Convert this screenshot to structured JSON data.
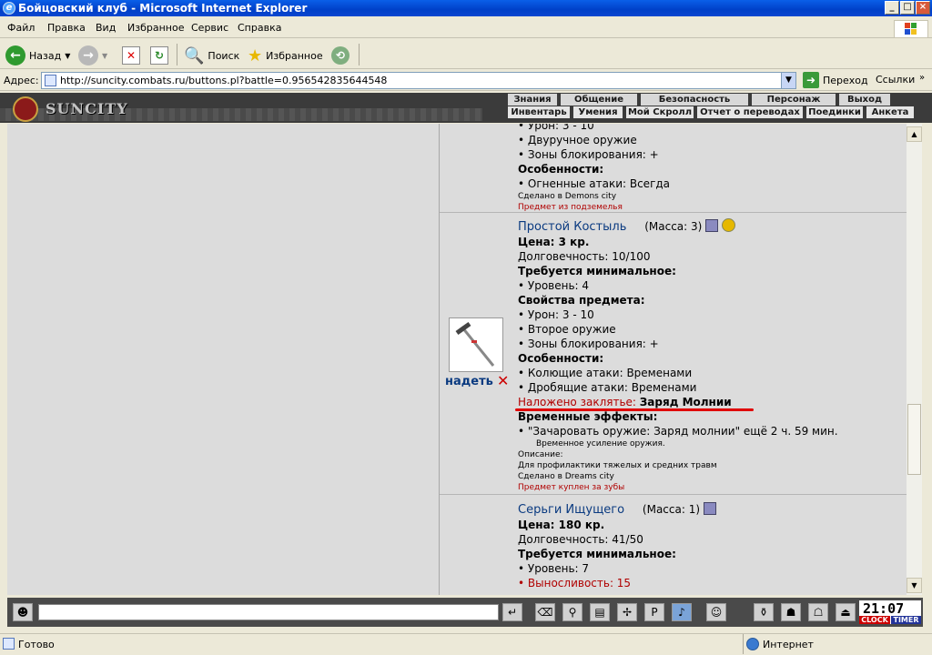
{
  "window": {
    "title": "Бойцовский клуб - Microsoft Internet Explorer"
  },
  "menu": [
    "Файл",
    "Правка",
    "Вид",
    "Избранное",
    "Сервис",
    "Справка"
  ],
  "toolbar": {
    "back": "Назад",
    "search": "Поиск",
    "favorites": "Избранное"
  },
  "address": {
    "label": "Адрес:",
    "url": "http://suncity.combats.ru/buttons.pl?battle=0.956542835644548",
    "go": "Переход",
    "links": "Ссылки"
  },
  "game": {
    "logo": "SUNCITY",
    "nav_top": [
      "Знания",
      "Общение",
      "Безопасность",
      "Персонаж",
      "Выход"
    ],
    "nav_bottom": [
      "Инвентарь",
      "Умения",
      "Мой Скролл",
      "Отчет о переводах",
      "Поединки",
      "Анкета"
    ]
  },
  "items": [
    {
      "lines_top": [
        "Урон: 3 - 10"
      ],
      "props": [
        "Двуручное оружие",
        "Зоны блокирования: +"
      ],
      "features_label": "Особенности:",
      "features": [
        "Огненные атаки: Всегда"
      ],
      "made": "Сделано в Demons city",
      "origin": "Предмет из подземелья"
    },
    {
      "name": "Простой Костыль",
      "mass": "(Масса: 3)",
      "price": "Цена: 3 кр.",
      "durability": "Долговечность: 10/100",
      "req_label": "Требуется минимальное:",
      "req": [
        "Уровень: 4"
      ],
      "props_label": "Свойства предмета:",
      "props": [
        "Урон: 3 - 10",
        "Второе оружие",
        "Зоны блокирования: +"
      ],
      "features_label": "Особенности:",
      "features": [
        "Колющие атаки: Временами",
        "Дробящие атаки: Временами"
      ],
      "spell_label": "Наложено заклятье:",
      "spell": "Заряд Молнии",
      "temp_label": "Временные эффекты:",
      "temp": "\"Зачаровать оружие: Заряд молнии\" ещё 2 ч. 59 мин.",
      "temp_desc": "Временное усиление оружия.",
      "desc_label": "Описание:",
      "desc": "Для профилактики тяжелых и средних травм",
      "made": "Сделано в Dreams city",
      "origin": "Предмет куплен за зубы",
      "equip": "надеть",
      "remove": "✕"
    },
    {
      "name": "Серьги Ищущего",
      "mass": "(Масса: 1)",
      "price": "Цена: 180 кр.",
      "durability": "Долговечность: 41/50",
      "req_label": "Требуется минимальное:",
      "req": [
        "Уровень: 7"
      ],
      "req_red": [
        "Выносливость: 15"
      ]
    }
  ],
  "clock": {
    "time": "21:07",
    "clock_label": "CLOCK",
    "timer_label": "TIMER"
  },
  "status": {
    "left": "Готово",
    "right": "Интернет"
  },
  "colors": {
    "accent_red": "#e00000",
    "link_blue": "#0a3a80",
    "xp_blue": "#0a46d0"
  }
}
